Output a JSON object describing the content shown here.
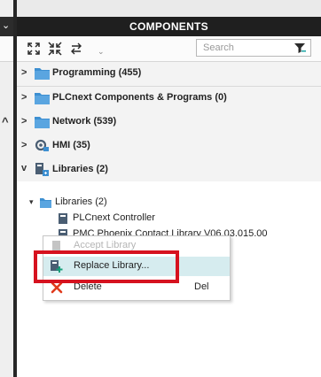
{
  "panel": {
    "title": "COMPONENTS"
  },
  "search": {
    "placeholder": "Search",
    "value": ""
  },
  "toolbar": {
    "icons": [
      "expand-all-icon",
      "collapse-all-icon",
      "swap-icon"
    ]
  },
  "categories": [
    {
      "label": "Programming (455)",
      "icon": "folder-icon",
      "state": "collapsed"
    },
    {
      "label": "PLCnext Components & Programs (0)",
      "icon": "folder-icon",
      "state": "collapsed"
    },
    {
      "label": "Network (539)",
      "icon": "folder-icon",
      "state": "collapsed"
    },
    {
      "label": "HMI (35)",
      "icon": "hmi-icon",
      "state": "collapsed"
    },
    {
      "label": "Libraries (2)",
      "icon": "library-icon",
      "state": "expanded"
    }
  ],
  "libraries_tree": {
    "folder_label": "Libraries (2)",
    "items": [
      "PLCnext Controller",
      "PMC Phoenix Contact Library V06.03.015.00"
    ]
  },
  "context_menu": {
    "items": [
      {
        "label": "Accept Library",
        "shortcut": "",
        "disabled": true
      },
      {
        "label": "Replace Library...",
        "shortcut": "",
        "highlighted": true
      },
      {
        "label": "Delete",
        "shortcut": "Del"
      }
    ]
  },
  "colors": {
    "header_bg": "#1f1f1f",
    "folder": "#3d8fd1",
    "highlight": "#d6ecef",
    "callout_red": "#d6121f",
    "delete_red": "#e03a1c"
  }
}
